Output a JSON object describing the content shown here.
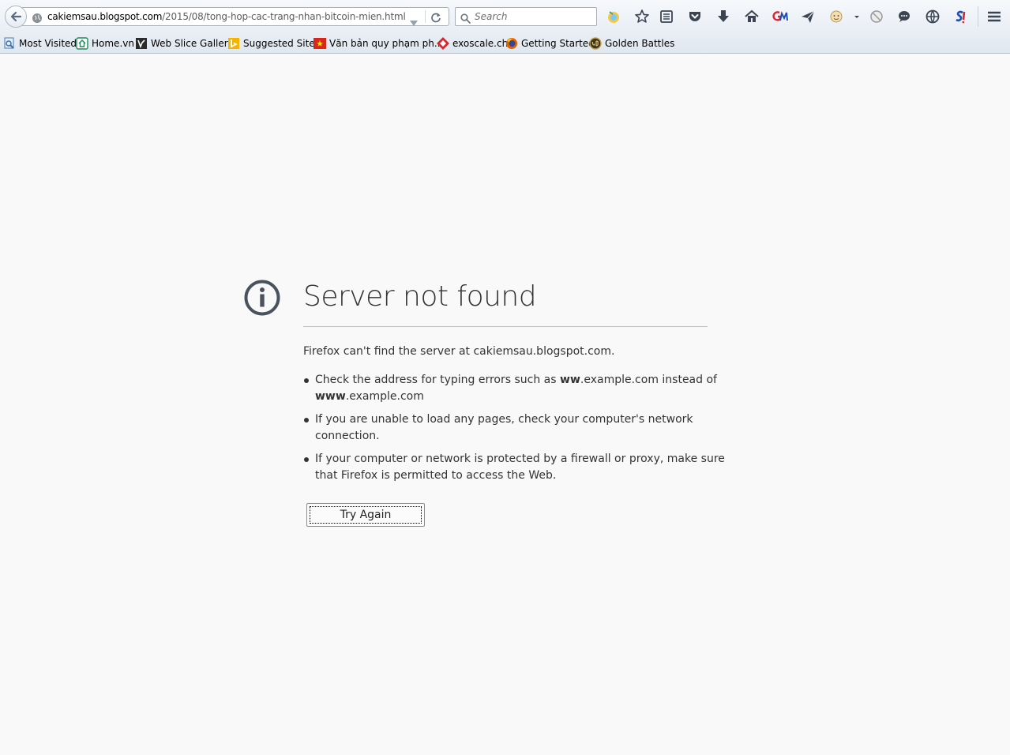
{
  "browser": {
    "url": {
      "host": "cakiemsau.blogspot.com",
      "path": "/2015/08/tong-hop-cac-trang-nhan-bitcoin-mien.html"
    },
    "search": {
      "placeholder": "Search"
    },
    "toolbar_icons": [
      "addon-icon",
      "bookmark-star-icon",
      "reading-list-icon",
      "pocket-icon",
      "downloads-icon",
      "home-icon",
      "gm-icon",
      "send-icon",
      "emoji-addon-icon",
      "dropdown-icon",
      "block-icon",
      "chat-icon",
      "globe-icon",
      "s-addon-icon",
      "menu-icon"
    ]
  },
  "bookmarks": [
    {
      "label": "Most Visited"
    },
    {
      "label": "Home.vn"
    },
    {
      "label": "Web Slice Gallery"
    },
    {
      "label": "Suggested Sites"
    },
    {
      "label": "Văn bản quy phạm ph..."
    },
    {
      "label": "exoscale.ch"
    },
    {
      "label": "Getting Started"
    },
    {
      "label": "Golden Battles"
    }
  ],
  "error": {
    "title": "Server not found",
    "description": "Firefox can't find the server at cakiemsau.blogspot.com.",
    "suggestions": [
      {
        "pre": "Check the address for typing errors such as ",
        "bold1": "ww",
        "mid": ".example.com instead of",
        "bold2": "www",
        "post": ".example.com"
      },
      {
        "line1": "If you are unable to load any pages, check your computer's network",
        "line2": "connection."
      },
      {
        "line1": "If your computer or network is protected by a firewall or proxy, make sure",
        "line2": "that Firefox is permitted to access the Web."
      }
    ],
    "button_label": "Try Again"
  },
  "colors": {
    "page_background": "#f9f9fa",
    "text": "#333333",
    "toolbar_top": "#f6f8fb",
    "toolbar_bottom": "#dfe7f0"
  }
}
